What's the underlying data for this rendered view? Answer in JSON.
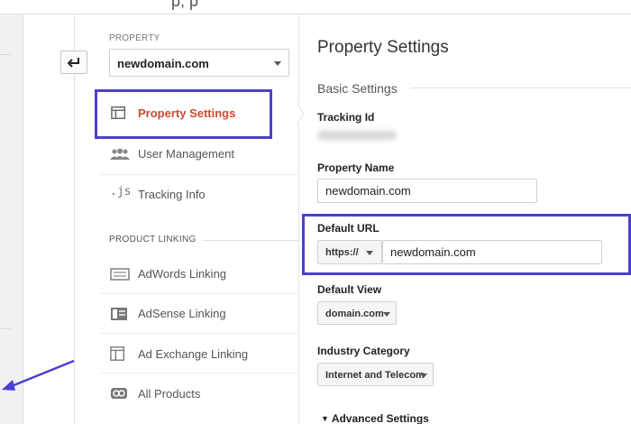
{
  "colors": {
    "accent_box": "#4b3fd0",
    "active_item": "#d04a2f"
  },
  "topbar": {
    "partial_text": "p,  p"
  },
  "property": {
    "label": "PROPERTY",
    "selected": "newdomain.com"
  },
  "nav": {
    "items": [
      {
        "label": "Property Settings",
        "icon": "layout-icon",
        "active": true
      },
      {
        "label": "User Management",
        "icon": "users-icon",
        "active": false
      },
      {
        "label": "Tracking Info",
        "icon": "js-icon",
        "active": false
      }
    ],
    "product_linking_label": "PRODUCT LINKING",
    "linking_items": [
      {
        "label": "AdWords Linking",
        "icon": "adwords-icon"
      },
      {
        "label": "AdSense Linking",
        "icon": "adsense-icon"
      },
      {
        "label": "Ad Exchange Linking",
        "icon": "ad-exchange-icon"
      },
      {
        "label": "All Products",
        "icon": "link-icon"
      }
    ]
  },
  "main": {
    "title": "Property Settings",
    "basic_settings": "Basic Settings",
    "tracking_id_label": "Tracking Id",
    "property_name_label": "Property Name",
    "property_name_value": "newdomain.com",
    "default_url_label": "Default URL",
    "protocol": "https://",
    "default_url_value": "newdomain.com",
    "default_view_label": "Default View",
    "default_view_value": "domain.com",
    "industry_label": "Industry Category",
    "industry_value": "Internet and Telecom",
    "advanced_label": "Advanced Settings"
  }
}
